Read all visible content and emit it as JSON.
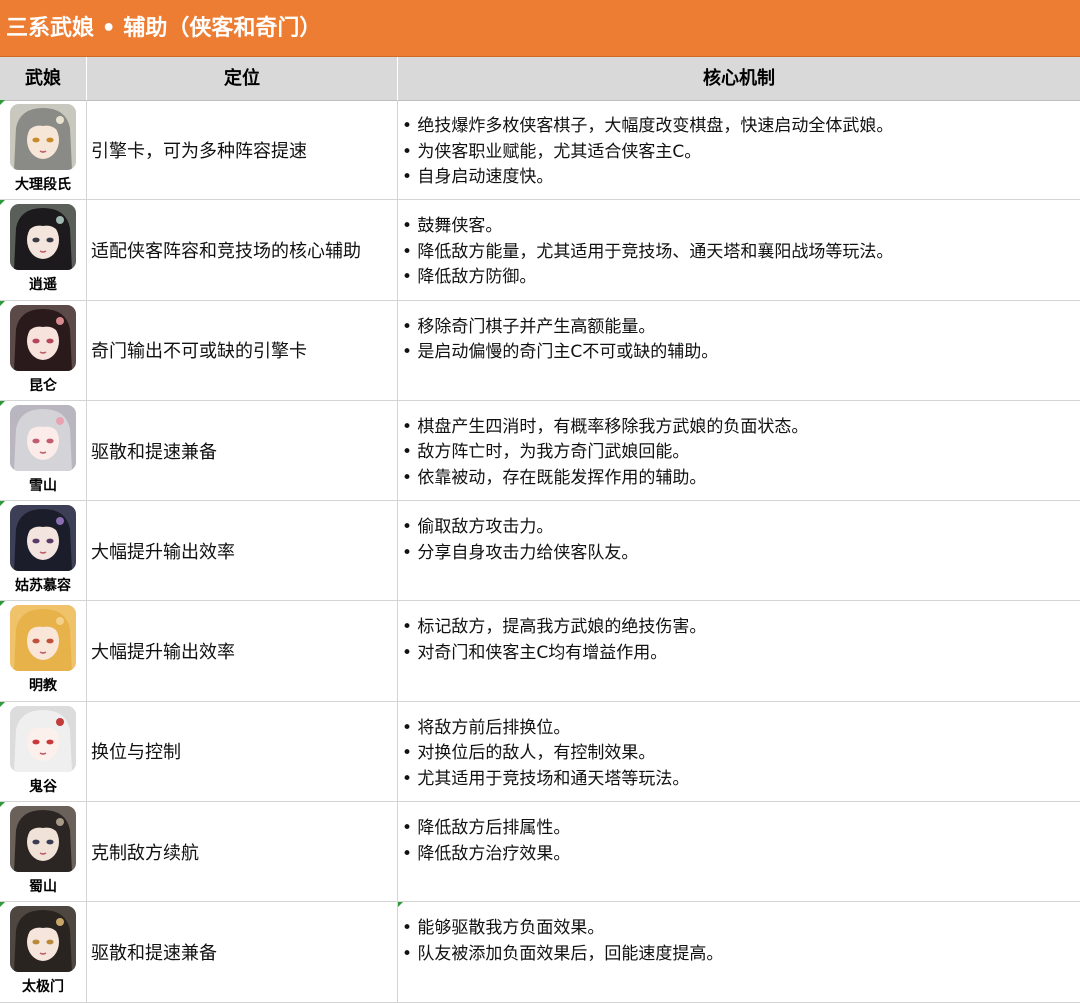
{
  "title": "三系武娘 • 辅助（侠客和奇门）",
  "columns": [
    "武娘",
    "定位",
    "核心机制"
  ],
  "rows": [
    {
      "name": "大理段氏",
      "role": "引擎卡，可为多种阵容提速",
      "mechanics": [
        "• 绝技爆炸多枚侠客棋子，大幅度改变棋盘，快速启动全体武娘。",
        "• 为侠客职业赋能，尤其适合侠客主C。",
        "• 自身启动速度快。"
      ],
      "portrait": {
        "hair": "#8a8a86",
        "bg": "#c9c8be",
        "skin": "#f6e6d8",
        "eyes": "#c98a2c",
        "accent": "#e9e2d0"
      }
    },
    {
      "name": "逍遥",
      "role": "适配侠客阵容和竞技场的核心辅助",
      "mechanics": [
        "• 鼓舞侠客。",
        "• 降低敌方能量，尤其适用于竞技场、通天塔和襄阳战场等玩法。",
        "• 降低敌方防御。"
      ],
      "portrait": {
        "hair": "#1c1a1c",
        "bg": "#5a5f5a",
        "skin": "#f3e4dc",
        "eyes": "#3a3a46",
        "accent": "#9fb7b0"
      }
    },
    {
      "name": "昆仑",
      "role": "奇门输出不可或缺的引擎卡",
      "mechanics": [
        "• 移除奇门棋子并产生高额能量。",
        "• 是启动偏慢的奇门主C不可或缺的辅助。"
      ],
      "portrait": {
        "hair": "#2a1a1c",
        "bg": "#5b4a48",
        "skin": "#f7e2dc",
        "eyes": "#b4455a",
        "accent": "#d88a90"
      }
    },
    {
      "name": "雪山",
      "role": "驱散和提速兼备",
      "mechanics": [
        "• 棋盘产生四消时，有概率移除我方武娘的负面状态。",
        "• 敌方阵亡时，为我方奇门武娘回能。",
        "• 依靠被动，存在既能发挥作用的辅助。"
      ],
      "portrait": {
        "hair": "#d4d4d8",
        "bg": "#b9b6c0",
        "skin": "#fbecea",
        "eyes": "#c25a70",
        "accent": "#e8a3b2"
      }
    },
    {
      "name": "姑苏慕容",
      "role": "大幅提升输出效率",
      "mechanics": [
        "• 偷取敌方攻击力。",
        "• 分享自身攻击力给侠客队友。"
      ],
      "portrait": {
        "hair": "#1b1d2a",
        "bg": "#3d3f56",
        "skin": "#f3e4e0",
        "eyes": "#5a3a66",
        "accent": "#8b6fb0"
      }
    },
    {
      "name": "明教",
      "role": "大幅提升输出效率",
      "mechanics": [
        "• 标记敌方，提高我方武娘的绝技伤害。",
        "• 对奇门和侠客主C均有增益作用。"
      ],
      "portrait": {
        "hair": "#e8b24a",
        "bg": "#f0c36a",
        "skin": "#f9e6d8",
        "eyes": "#c0503a",
        "accent": "#f4d08a"
      }
    },
    {
      "name": "鬼谷",
      "role": "换位与控制",
      "mechanics": [
        "• 将敌方前后排换位。",
        "• 对换位后的敌人，有控制效果。",
        "• 尤其适用于竞技场和通天塔等玩法。"
      ],
      "portrait": {
        "hair": "#efefef",
        "bg": "#dcdcdc",
        "skin": "#fbf0ec",
        "eyes": "#c83a3a",
        "accent": "#c23c3c"
      }
    },
    {
      "name": "蜀山",
      "role": "克制敌方续航",
      "mechanics": [
        "• 降低敌方后排属性。",
        "• 降低敌方治疗效果。"
      ],
      "portrait": {
        "hair": "#2b2623",
        "bg": "#6a625a",
        "skin": "#f1e2d8",
        "eyes": "#3a3d52",
        "accent": "#a89a86"
      }
    },
    {
      "name": "太极门",
      "role": "驱散和提速兼备",
      "mechanics": [
        "• 能够驱散我方负面效果。",
        "• 队友被添加负面效果后，回能速度提高。"
      ],
      "portrait": {
        "hair": "#2a2420",
        "bg": "#4e4640",
        "skin": "#f5e5da",
        "eyes": "#b88a3a",
        "accent": "#c9a66a"
      }
    }
  ]
}
